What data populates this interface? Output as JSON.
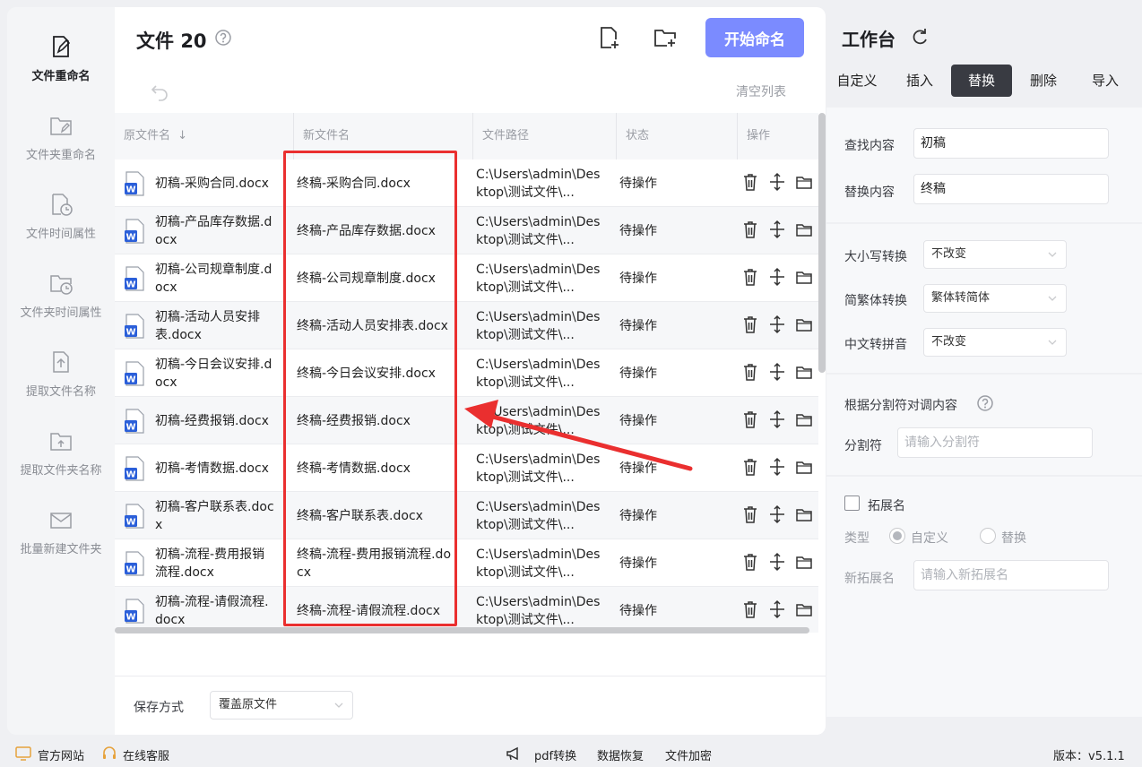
{
  "sidebar": {
    "items": [
      {
        "label": "文件重命名",
        "icon": "file-edit-icon",
        "active": true
      },
      {
        "label": "文件夹重命名",
        "icon": "folder-edit-icon"
      },
      {
        "label": "文件时间属性",
        "icon": "file-clock-icon"
      },
      {
        "label": "文件夹时间属性",
        "icon": "folder-clock-icon"
      },
      {
        "label": "提取文件名称",
        "icon": "file-upload-icon"
      },
      {
        "label": "提取文件夹名称",
        "icon": "folder-upload-icon"
      },
      {
        "label": "批量新建文件夹",
        "icon": "folder-mail-icon"
      }
    ]
  },
  "main": {
    "title_prefix": "文件",
    "file_count": "20",
    "start_button": "开始命名",
    "clear_list": "清空列表",
    "columns": [
      "原文件名",
      "新文件名",
      "文件路径",
      "状态",
      "操作"
    ],
    "rows": [
      {
        "orig": "初稿-采购合同.docx",
        "new": "终稿-采购合同.docx",
        "path": "C:\\Users\\admin\\Desktop\\测试文件\\...",
        "status": "待操作"
      },
      {
        "orig": "初稿-产品库存数据.docx",
        "new": "终稿-产品库存数据.docx",
        "path": "C:\\Users\\admin\\Desktop\\测试文件\\...",
        "status": "待操作"
      },
      {
        "orig": "初稿-公司规章制度.docx",
        "new": "终稿-公司规章制度.docx",
        "path": "C:\\Users\\admin\\Desktop\\测试文件\\...",
        "status": "待操作"
      },
      {
        "orig": "初稿-活动人员安排表.docx",
        "new": "终稿-活动人员安排表.docx",
        "path": "C:\\Users\\admin\\Desktop\\测试文件\\...",
        "status": "待操作"
      },
      {
        "orig": "初稿-今日会议安排.docx",
        "new": "终稿-今日会议安排.docx",
        "path": "C:\\Users\\admin\\Desktop\\测试文件\\...",
        "status": "待操作"
      },
      {
        "orig": "初稿-经费报销.docx",
        "new": "终稿-经费报销.docx",
        "path": "C:\\Users\\admin\\Desktop\\测试文件\\...",
        "status": "待操作"
      },
      {
        "orig": "初稿-考情数据.docx",
        "new": "终稿-考情数据.docx",
        "path": "C:\\Users\\admin\\Desktop\\测试文件\\...",
        "status": "待操作"
      },
      {
        "orig": "初稿-客户联系表.docx",
        "new": "终稿-客户联系表.docx",
        "path": "C:\\Users\\admin\\Desktop\\测试文件\\...",
        "status": "待操作"
      },
      {
        "orig": "初稿-流程-费用报销流程.docx",
        "new": "终稿-流程-费用报销流程.docx",
        "path": "C:\\Users\\admin\\Desktop\\测试文件\\...",
        "status": "待操作"
      },
      {
        "orig": "初稿-流程-请假流程.docx",
        "new": "终稿-流程-请假流程.docx",
        "path": "C:\\Users\\admin\\Desktop\\测试文件\\...",
        "status": "待操作"
      }
    ],
    "save_label": "保存方式",
    "save_value": "覆盖原文件"
  },
  "workbench": {
    "title": "工作台",
    "tabs": [
      "自定义",
      "插入",
      "替换",
      "删除",
      "导入"
    ],
    "active_tab": "替换",
    "find_label": "查找内容",
    "find_value": "初稿",
    "replace_label": "替换内容",
    "replace_value": "终稿",
    "case_label": "大小写转换",
    "case_value": "不改变",
    "trad_label": "简繁体转换",
    "trad_value": "繁体转简体",
    "pinyin_label": "中文转拼音",
    "pinyin_value": "不改变",
    "split_title": "根据分割符对调内容",
    "split_label": "分割符",
    "split_placeholder": "请输入分割符",
    "ext_label": "拓展名",
    "type_label": "类型",
    "type_custom": "自定义",
    "type_replace": "替换",
    "new_ext_label": "新拓展名",
    "new_ext_placeholder": "请输入新拓展名"
  },
  "footer": {
    "website": "官方网站",
    "service": "在线客服",
    "pdf": "pdf转换",
    "recovery": "数据恢复",
    "encrypt": "文件加密",
    "version": "版本：v5.1.1"
  },
  "colors": {
    "accent": "#7b8bff",
    "active_tab": "#393b42",
    "highlight": "#ea2f2f",
    "word_blue": "#2b5fd9"
  }
}
